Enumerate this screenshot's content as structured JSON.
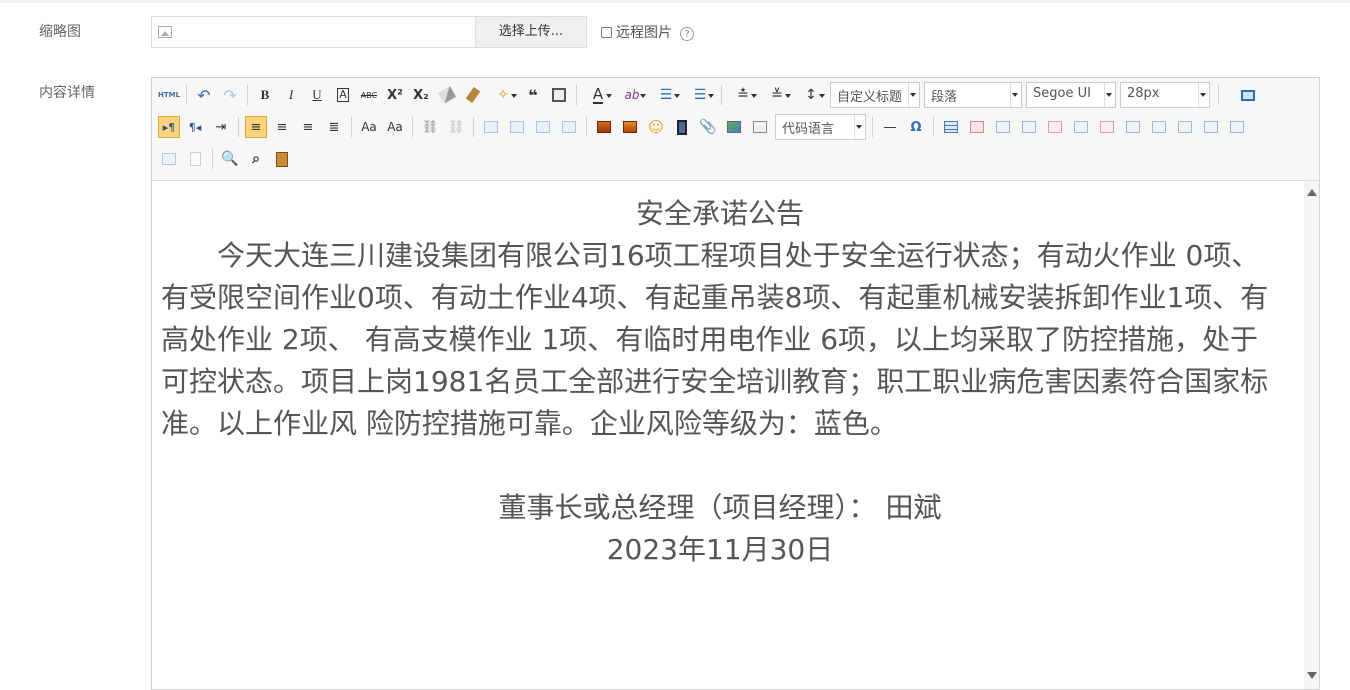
{
  "form": {
    "thumbnail_label": "缩略图",
    "upload_button": "选择上传...",
    "remote_image_label": "远程图片",
    "help_symbol": "?",
    "content_label": "内容详情"
  },
  "toolbar": {
    "html_label": "HTML",
    "bold": "B",
    "italic": "I",
    "underline": "U",
    "font_border": "A",
    "strike": "ABC",
    "font_color": "A",
    "horizontal_rule": "—",
    "special_char": "Ω",
    "custom_title": "自定义标题",
    "paragraph": "段落",
    "font_family": "Segoe UI",
    "font_size": "28px",
    "code_language": "代码语言"
  },
  "document": {
    "title": "安全承诺公告",
    "body": "今天大连三川建设集团有限公司16项工程项目处于安全运行状态；有动火作业 0项、有受限空间作业0项、有动土作业4项、有起重吊装8项、有起重机械安装拆卸作业1项、有高处作业 2项、 有高支模作业 1项、有临时用电作业 6项，以上均采取了防控措施，处于可控状态。项目上岗1981名员工全部进行安全培训教育；职工职业病危害因素符合国家标准。以上作业风 险防控措施可靠。企业风险等级为：蓝色。",
    "signature": "董事长或总经理（项目经理）：  田斌",
    "date": "2023年11月30日"
  }
}
